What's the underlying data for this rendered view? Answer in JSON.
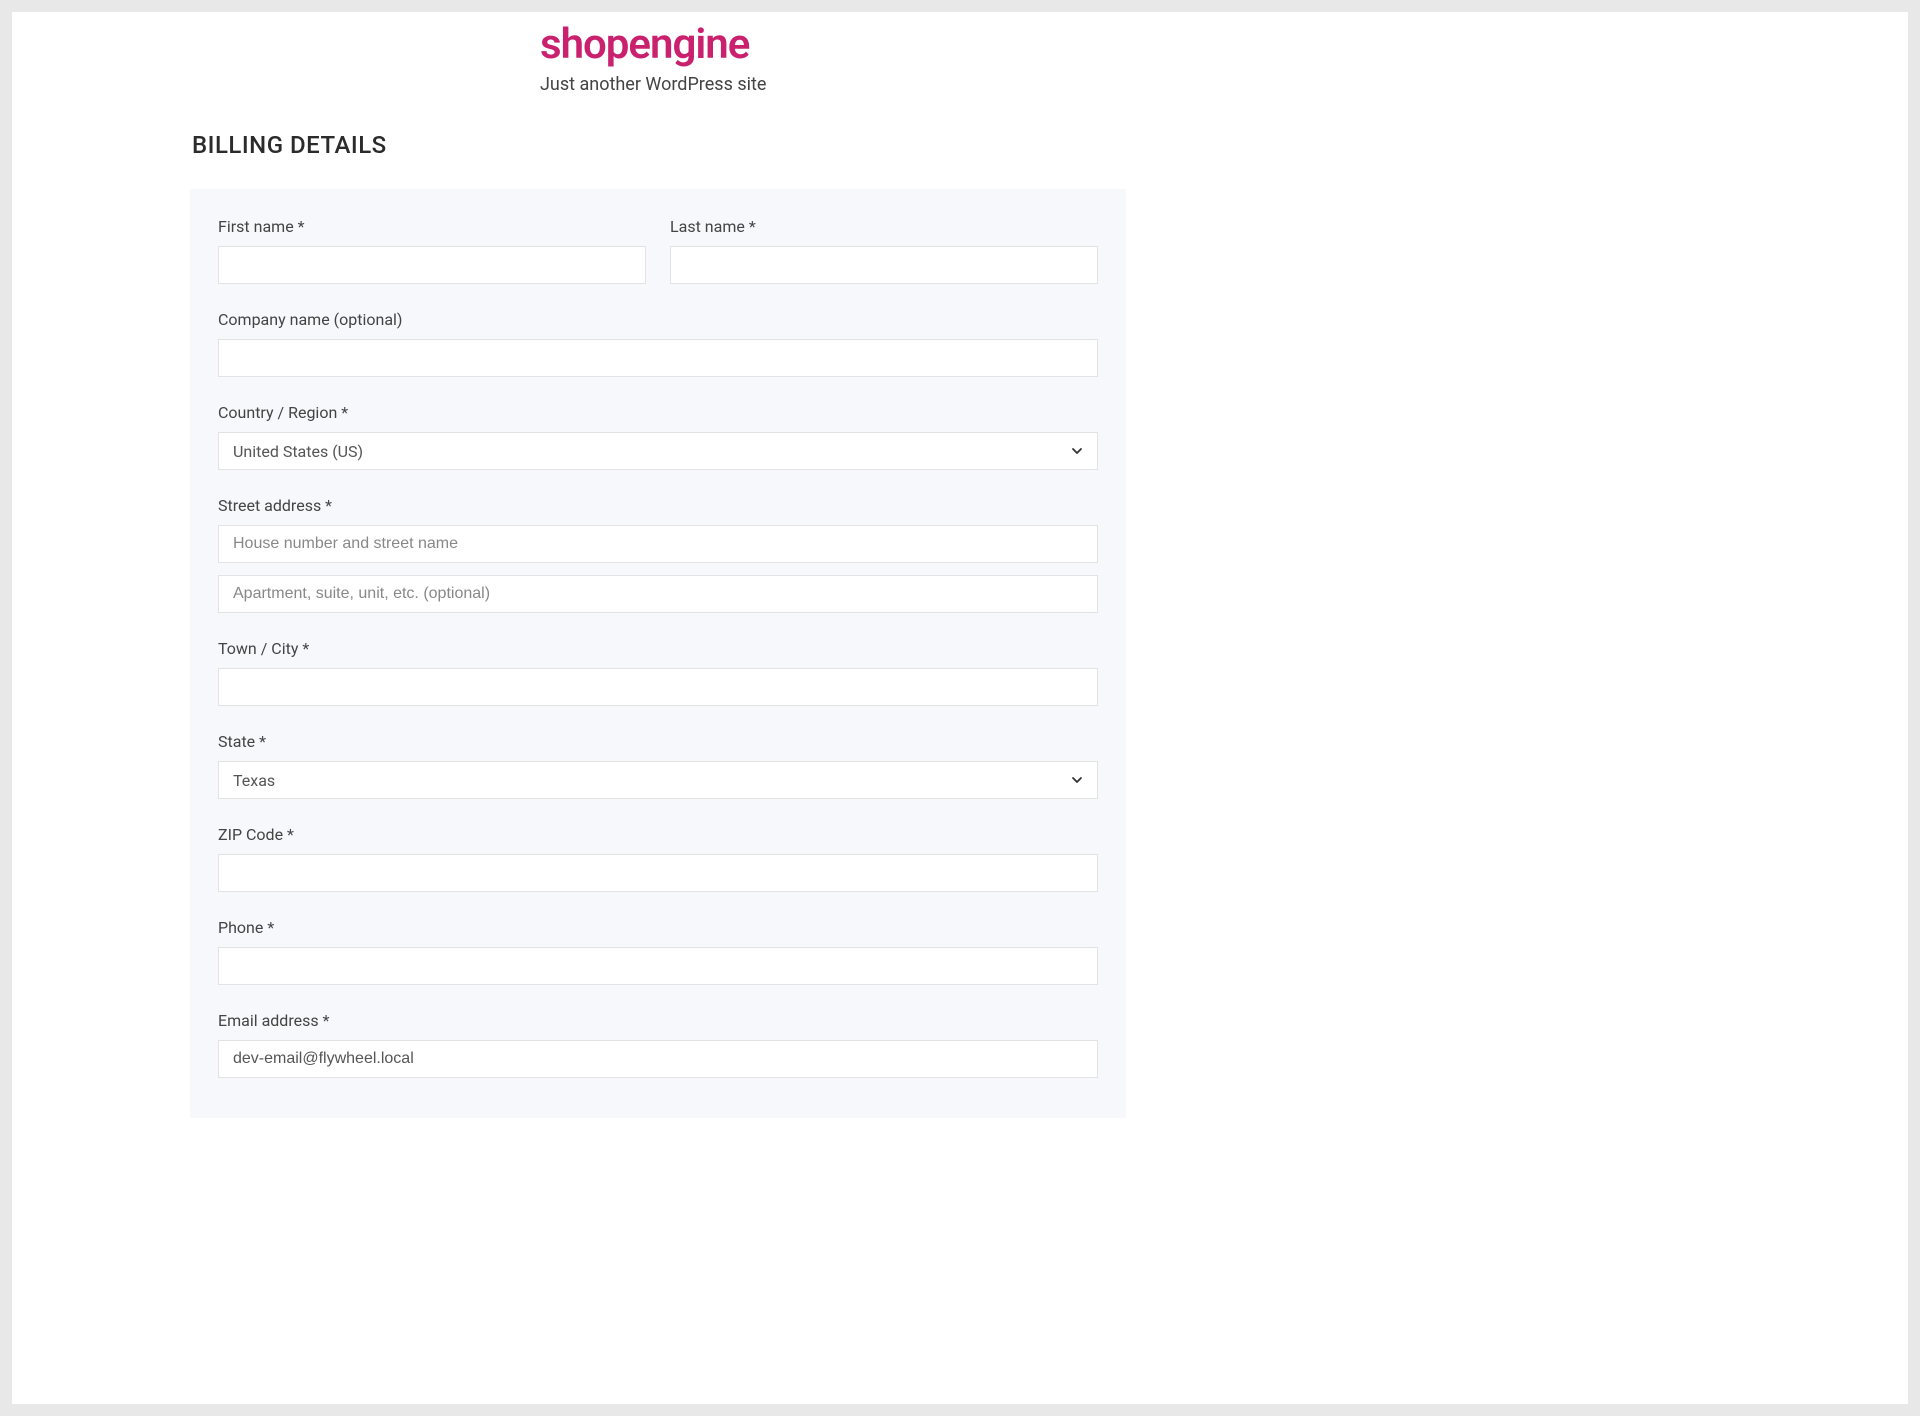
{
  "header": {
    "site_title": "shopengine",
    "tagline": "Just another WordPress site"
  },
  "section_heading": "BILLING DETAILS",
  "fields": {
    "first_name": {
      "label": "First name ",
      "req": "*",
      "value": ""
    },
    "last_name": {
      "label": "Last name ",
      "req": "*",
      "value": ""
    },
    "company": {
      "label": "Company name (optional)",
      "req": "",
      "value": ""
    },
    "country": {
      "label": "Country / Region ",
      "req": "*",
      "selected": "United States (US)"
    },
    "street": {
      "label": "Street address ",
      "req": "*",
      "placeholder1": "House number and street name",
      "placeholder2": "Apartment, suite, unit, etc. (optional)",
      "value1": "",
      "value2": ""
    },
    "city": {
      "label": "Town / City ",
      "req": "*",
      "value": ""
    },
    "state": {
      "label": "State ",
      "req": "*",
      "selected": "Texas"
    },
    "zip": {
      "label": "ZIP Code ",
      "req": "*",
      "value": ""
    },
    "phone": {
      "label": "Phone ",
      "req": "*",
      "value": ""
    },
    "email": {
      "label": "Email address ",
      "req": "*",
      "value": "dev-email@flywheel.local"
    }
  }
}
